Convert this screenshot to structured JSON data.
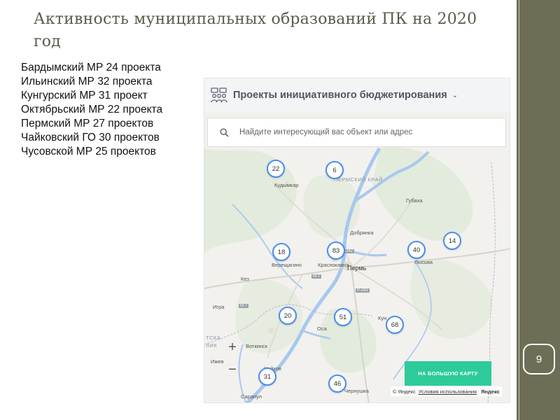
{
  "slide": {
    "title": "Активность муниципальных образований ПК на 2020 год",
    "page_number": "9"
  },
  "projects": [
    "Бардымский МР 24 проекта",
    "Ильинский МР 32 проекта",
    "Кунгурский МР 31 проект",
    "Октябрьский МР 22 проекта",
    "Пермский МР 27 проектов",
    "Чайковский ГО 30 проектов",
    "Чусовской МР 25 проектов"
  ],
  "widget": {
    "title": "Проекты инициативного бюджетирования",
    "search_placeholder": "Найдите интересующий вас объект или адрес",
    "big_map_button": "НА БОЛЬШУЮ КАРТУ",
    "copyright": "© Яндекс",
    "terms_link": "Условия использования",
    "logo": "Яндекс",
    "zoom_in": "+",
    "zoom_out": "−",
    "clusters": [
      "22",
      "6",
      "18",
      "83",
      "40",
      "14",
      "20",
      "51",
      "68",
      "31",
      "46"
    ],
    "places": [
      "Кудымкар",
      "ПЕРМСКИЙ КРАЙ",
      "Губаха",
      "Добрянка",
      "Верещагино",
      "Краснокамск",
      "Пермь",
      "Лысьва",
      "Кез",
      "Игра",
      "Кун",
      "Оса",
      "Воткинск",
      "Ижев",
      "Чайков",
      "Сарапул",
      "Чернушка",
      "ТСКА",
      "ЛИК"
    ],
    "roads": [
      "М-7",
      "М-7",
      "Р-242",
      "Р-242"
    ],
    "colors": {
      "cluster_border": "#4a8df2",
      "button": "#2ecb9a",
      "water": "#a7c8ef"
    }
  }
}
